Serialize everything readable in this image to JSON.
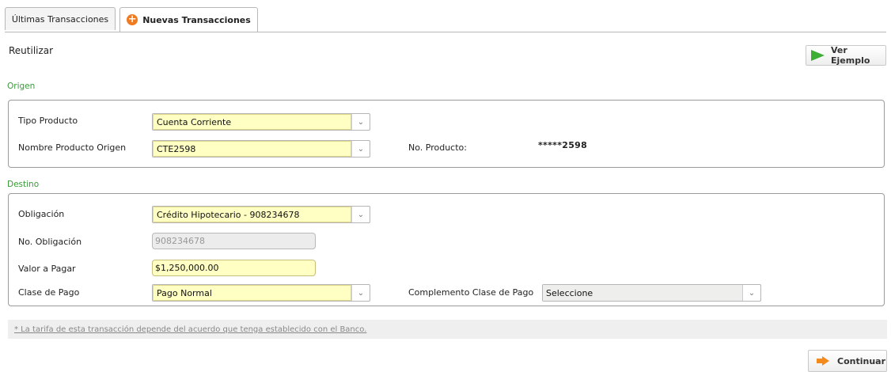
{
  "tabs": [
    {
      "label": "Últimas Transacciones",
      "active": false
    },
    {
      "label": "Nuevas Transacciones",
      "active": true,
      "icon": "plus-circle-icon"
    }
  ],
  "reutilizar_label": "Reutilizar",
  "ver_ejemplo_label": "Ver Ejemplo",
  "origen": {
    "title": "Origen",
    "tipo_producto": {
      "label": "Tipo Producto",
      "value": "Cuenta Corriente"
    },
    "nombre_producto": {
      "label": "Nombre Producto Origen",
      "value": "CTE2598"
    },
    "no_producto": {
      "label": "No. Producto:",
      "value": "*****2598"
    }
  },
  "destino": {
    "title": "Destino",
    "obligacion": {
      "label": "Obligación",
      "value": "Crédito Hipotecario - 908234678"
    },
    "no_obligacion": {
      "label": "No. Obligación",
      "value": "908234678"
    },
    "valor_pagar": {
      "label": "Valor a Pagar",
      "value": "$1,250,000.00"
    },
    "clase_pago": {
      "label": "Clase de Pago",
      "value": "Pago Normal"
    },
    "complemento": {
      "label": "Complemento Clase de Pago",
      "value": "Seleccione"
    }
  },
  "note": "* La tarifa de esta transacción depende del acuerdo que tenga establecido con el Banco.",
  "continuar_label": "Continuar",
  "colors": {
    "accent_green": "#3a9a3a",
    "accent_orange": "#f07b22",
    "field_yellow": "#ffffc4"
  }
}
